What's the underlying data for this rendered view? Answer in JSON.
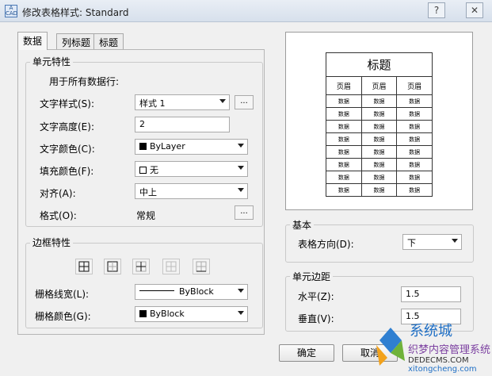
{
  "window": {
    "title": "修改表格样式: Standard",
    "app_icon_text": "A\nCAD",
    "help_symbol": "?",
    "close_symbol": "✕"
  },
  "tabs": [
    {
      "label": "数据",
      "active": true
    },
    {
      "label": "列标题",
      "active": false
    },
    {
      "label": "标题",
      "active": false
    }
  ],
  "cell_props": {
    "group_title": "单元特性",
    "apply_all": "用于所有数据行:",
    "text_style": {
      "label": "文字样式(S):",
      "value": "样式 1",
      "more": "..."
    },
    "text_height": {
      "label": "文字高度(E):",
      "value": "2"
    },
    "text_color": {
      "label": "文字颜色(C):",
      "value": "ByLayer"
    },
    "fill_color": {
      "label": "填充颜色(F):",
      "value": "无"
    },
    "alignment": {
      "label": "对齐(A):",
      "value": "中上"
    },
    "format": {
      "label": "格式(O):",
      "value": "常规",
      "more": "..."
    }
  },
  "border_props": {
    "group_title": "边框特性",
    "buttons": [
      "all-borders",
      "outside-borders",
      "inside-borders",
      "no-borders",
      "bottom-border"
    ],
    "line_width": {
      "label": "栅格线宽(L):",
      "value": "ByBlock"
    },
    "line_color": {
      "label": "栅格颜色(G):",
      "value": "ByBlock"
    }
  },
  "preview": {
    "title": "标题",
    "header": "页眉",
    "data": "数据",
    "data_rows": 8
  },
  "basic": {
    "group_title": "基本",
    "direction_label": "表格方向(D):",
    "direction_value": "下"
  },
  "margins": {
    "group_title": "单元边距",
    "horizontal_label": "水平(Z):",
    "horizontal_value": "1.5",
    "vertical_label": "垂直(V):",
    "vertical_value": "1.5"
  },
  "buttons": {
    "ok": "确定",
    "cancel": "取消"
  },
  "watermark": {
    "line1": "系统城",
    "line2": "织梦内容管理系统",
    "line3": "DEDECMS.COM",
    "line4": "xitongcheng.com"
  },
  "colors": {
    "window_bg": "#f0f0f0",
    "title_bg": "#dce4ef"
  }
}
